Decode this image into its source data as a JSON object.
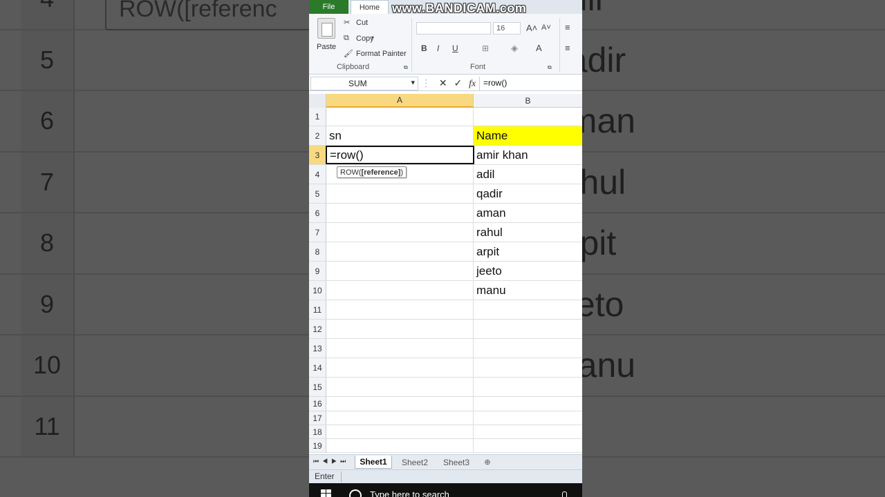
{
  "background": {
    "row_numbers": [
      "4",
      "5",
      "6",
      "7",
      "8",
      "9",
      "10",
      "11"
    ],
    "names": [
      "adil",
      "qadir",
      "aman",
      "rahul",
      "arpit",
      "jeeto",
      "manu",
      ""
    ],
    "tooltip": "ROW([referenc"
  },
  "ribbon": {
    "tabs": {
      "file": "File",
      "home": "Home"
    },
    "watermark": "www.BANDICAM.com",
    "clipboard": {
      "paste": "Paste",
      "cut": "Cut",
      "copy": "Copy",
      "format_painter": "Format Painter",
      "label": "Clipboard"
    },
    "font": {
      "size": "16",
      "label": "Font",
      "bold": "B",
      "italic": "I",
      "underline": "U"
    }
  },
  "formula_bar": {
    "name_box": "SUM",
    "formula": "=row()",
    "cancel_icon": "✕",
    "enter_icon": "✓",
    "fx": "fx"
  },
  "grid": {
    "columns": [
      "A",
      "B"
    ],
    "rows": [
      {
        "num": "1",
        "a": "",
        "b": ""
      },
      {
        "num": "2",
        "a": "sn",
        "b": "Name"
      },
      {
        "num": "3",
        "a": "=row()",
        "b": "amir khan"
      },
      {
        "num": "4",
        "a": "",
        "b": "adil"
      },
      {
        "num": "5",
        "a": "",
        "b": "qadir"
      },
      {
        "num": "6",
        "a": "",
        "b": "aman"
      },
      {
        "num": "7",
        "a": "",
        "b": "rahul"
      },
      {
        "num": "8",
        "a": "",
        "b": "arpit"
      },
      {
        "num": "9",
        "a": "",
        "b": "jeeto"
      },
      {
        "num": "10",
        "a": "",
        "b": "manu"
      },
      {
        "num": "11",
        "a": "",
        "b": ""
      },
      {
        "num": "12",
        "a": "",
        "b": ""
      },
      {
        "num": "13",
        "a": "",
        "b": ""
      },
      {
        "num": "14",
        "a": "",
        "b": ""
      },
      {
        "num": "15",
        "a": "",
        "b": ""
      },
      {
        "num": "16",
        "a": "",
        "b": ""
      },
      {
        "num": "17",
        "a": "",
        "b": ""
      },
      {
        "num": "18",
        "a": "",
        "b": ""
      },
      {
        "num": "19",
        "a": "",
        "b": ""
      }
    ],
    "tooltip": {
      "prefix": "ROW(",
      "arg": "[reference]",
      "suffix": ")"
    }
  },
  "sheets": [
    "Sheet1",
    "Sheet2",
    "Sheet3"
  ],
  "status": {
    "mode": "Enter"
  },
  "taskbar": {
    "search": "Type here to search"
  },
  "colors": {
    "header_yellow": "#ffff00",
    "active_header": "#f9d980",
    "file_tab": "#2a7a2a"
  }
}
